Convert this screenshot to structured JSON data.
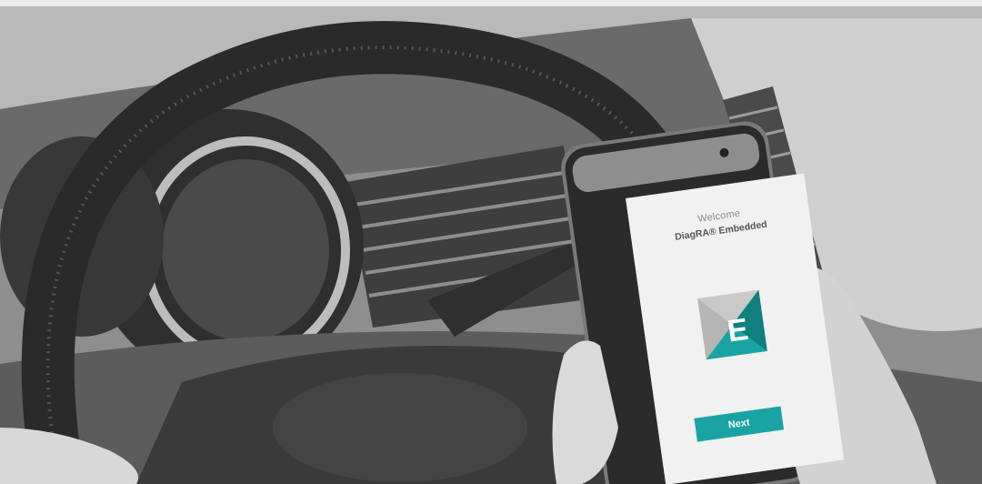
{
  "phone": {
    "welcome_text": "Welcome",
    "app_name": "DiagRA® Embedded",
    "logo_letter": "E",
    "next_label": "Next"
  },
  "colors": {
    "accent": "#1aa3a3",
    "logo_dark": "#0f7f7f",
    "logo_grey": "#9a9a9a",
    "screen": "#f1f1f1"
  },
  "icons": [
    "app-logo-icon"
  ]
}
